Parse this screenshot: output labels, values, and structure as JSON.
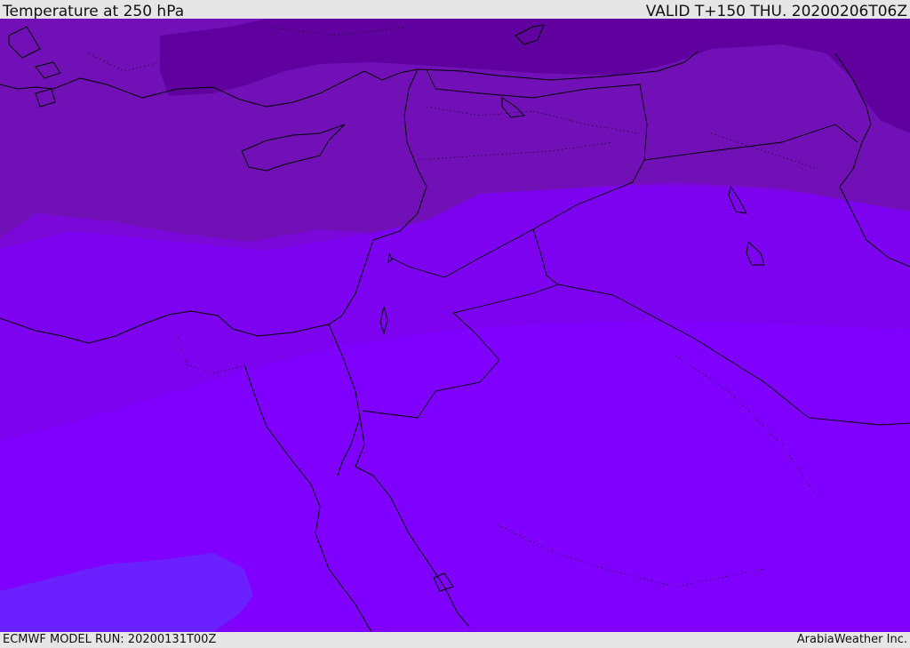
{
  "header": {
    "title": "Temperature at 250 hPa",
    "valid": "VALID T+150 THU. 20200206T06Z"
  },
  "footer": {
    "model_run": "ECMWF MODEL RUN: 20200131T00Z",
    "credit": "ArabiaWeather Inc."
  },
  "map": {
    "colors": {
      "band_darkest": "#5e009f",
      "band_dark": "#7110b6",
      "band_mid": "#7a0ad4",
      "band_light": "#8000f5",
      "band_lightest": "#7f00ff",
      "band_blue": "#6a1fff",
      "coast": "#000000"
    }
  }
}
